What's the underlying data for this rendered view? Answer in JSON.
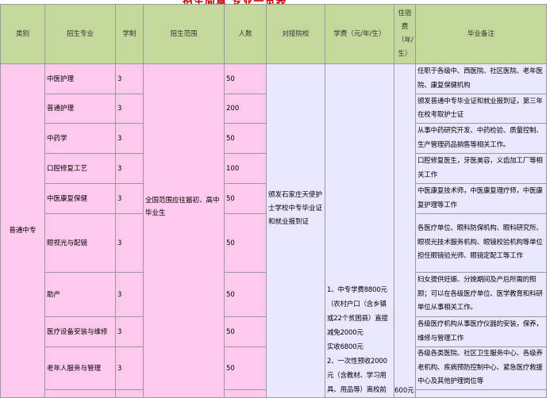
{
  "page_title": "招生简章 专业一览表",
  "headers": [
    "类别",
    "招生专业",
    "学制",
    "招生范围",
    "人数",
    "对接院校",
    "学费（元/年/生）",
    "住宿费（年/生）",
    "毕业备注"
  ],
  "category": "普通中专",
  "scope": "全国范围应往届初、高中毕业生",
  "school": "颁发石家庄天使护士学校中专毕业证和就业报到证",
  "fee_lines": [
    "1、中专学费8800元",
    "（农村户口（含乡镇",
    "或22个贫困县）直接",
    "减免2000元",
    "实收6800元",
    "2、一次性预收2000",
    "元（含教材、学习用",
    "具、用品等）离校前"
  ],
  "dorm_fee": "600元",
  "rows": [
    {
      "major": "中医护理",
      "years": "3",
      "count": "50",
      "note": "任职于各级中、西医院、社区医院、老年医院、康复保健机构"
    },
    {
      "major": "普通护理",
      "years": "3",
      "count": "200",
      "note": "颁发普通中专毕业证和就业报到证，第三年在校考取护士证"
    },
    {
      "major": "中药学",
      "years": "3",
      "count": "50",
      "note": "从事中药研究开发、中药检验、质量控制、生产管理药品销售等相关工作。"
    },
    {
      "major": "口腔修复工艺",
      "years": "3",
      "count": "100",
      "note": "口腔修复医生，牙医美容，义齿加工厂等相关工作"
    },
    {
      "major": "中医康复保健",
      "years": "3",
      "count": "50",
      "note": "中医康复技术师，中医康复理疗师，中医康复护理等工作"
    },
    {
      "major": "眼视光与配镜",
      "years": "3",
      "count": "50",
      "note": "各医疗单位、眼科防保机构、眼科研究所、眼视光技术服务机构、眼镜校验机构等单位担任眼镜验光师、眼镜定配工等工作"
    },
    {
      "major": "助产",
      "years": "3",
      "count": "50",
      "note": "妇女提供妊娠、分娩期间及产后所需的照顾；可以在各级医疗单位、医学教育和科研单位从事相关工作。"
    },
    {
      "major": "医疗设备安装与维修",
      "years": "3",
      "count": "50",
      "note": "各级医疗机构从事医疗仪器的安装，保养，维修与管理工作"
    },
    {
      "major": "老年人服务与管理",
      "years": "3",
      "count": "50",
      "note": "各级各类医院、社区卫生服务中心、各级养老机构、疾病预防控制中心、紧急医疗救援中心及其他护理岗位等"
    }
  ]
}
